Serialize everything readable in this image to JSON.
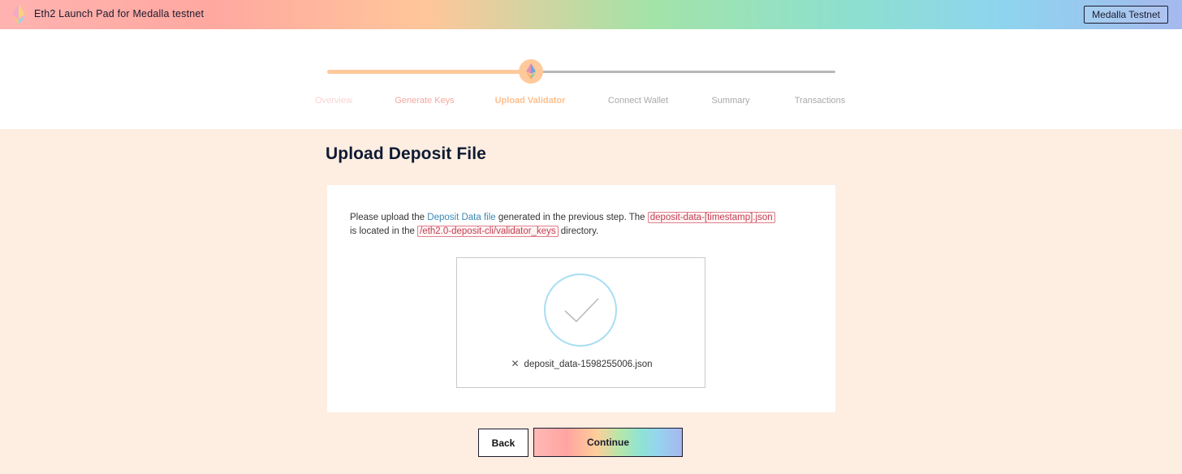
{
  "header": {
    "app_title": "Eth2 Launch Pad for Medalla testnet",
    "network_button": "Medalla Testnet",
    "logo_icon": "ethereum-logo-icon"
  },
  "stepper": {
    "steps": [
      {
        "label": "Overview",
        "state": "done"
      },
      {
        "label": "Generate Keys",
        "state": "done"
      },
      {
        "label": "Upload Validator",
        "state": "current"
      },
      {
        "label": "Connect Wallet",
        "state": "upcoming"
      },
      {
        "label": "Summary",
        "state": "upcoming"
      },
      {
        "label": "Transactions",
        "state": "upcoming"
      }
    ]
  },
  "main": {
    "title": "Upload Deposit File",
    "instructions": {
      "part1": "Please upload the ",
      "link": "Deposit Data file",
      "part2": " generated in the previous step. The ",
      "code1": "deposit-data-[timestamp].json",
      "part3": " is located in the ",
      "code2": "/eth2.0-deposit-cli/validator_keys",
      "part4": " directory."
    },
    "upload": {
      "filename": "deposit_data-1598255006.json",
      "status_icon": "check-circle-icon",
      "remove_icon": "close-icon"
    }
  },
  "actions": {
    "back": "Back",
    "continue": "Continue"
  },
  "colors": {
    "progress": "#ffc99b",
    "track": "#b8b8b8",
    "check": "#a9def3",
    "link": "#3b87b5",
    "code": "#c33d4f"
  }
}
